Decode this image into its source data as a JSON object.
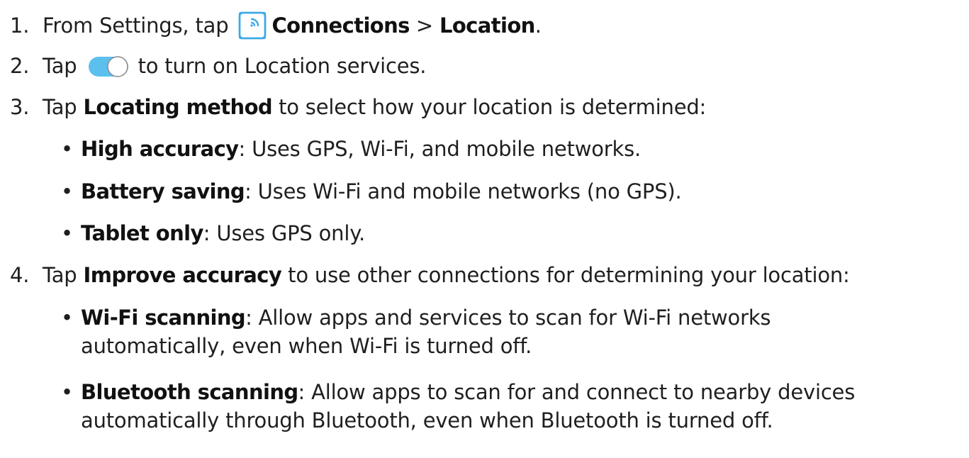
{
  "steps": [
    {
      "number": "1.",
      "before": "From Settings, tap",
      "icon": "connections-icon",
      "bold1": "Connections",
      "separator": " > ",
      "bold2": "Location",
      "after": "."
    },
    {
      "number": "2.",
      "before": "Tap",
      "icon": "toggle-switch-icon",
      "after": "to turn on Location services."
    },
    {
      "number": "3.",
      "before": "Tap ",
      "bold": "Locating method",
      "after": " to select how your location is determined:",
      "bullets": [
        {
          "term": "High accuracy",
          "text": ": Uses GPS, Wi-Fi, and mobile networks."
        },
        {
          "term": "Battery saving",
          "text": ": Uses Wi-Fi and mobile networks (no GPS)."
        },
        {
          "term": "Tablet only",
          "text": ": Uses GPS only."
        }
      ]
    },
    {
      "number": "4.",
      "before": "Tap ",
      "bold": "Improve accuracy",
      "after": " to use other connections for determining your location:",
      "bullets": [
        {
          "term": "Wi-Fi scanning",
          "text": ": Allow apps and services to scan for Wi-Fi networks",
          "continuation": "automatically, even when Wi-Fi is turned off."
        },
        {
          "term": "Bluetooth scanning",
          "text": ": Allow apps to scan for and connect to nearby devices",
          "continuation": "automatically through Bluetooth, even when Bluetooth is turned off."
        }
      ]
    }
  ],
  "bullet_glyph": "•",
  "colors": {
    "text": "#1f1f1f",
    "icon_blue": "#3da9e6",
    "toggle_track": "#5bc0ee",
    "toggle_border": "#8a8a8a"
  }
}
